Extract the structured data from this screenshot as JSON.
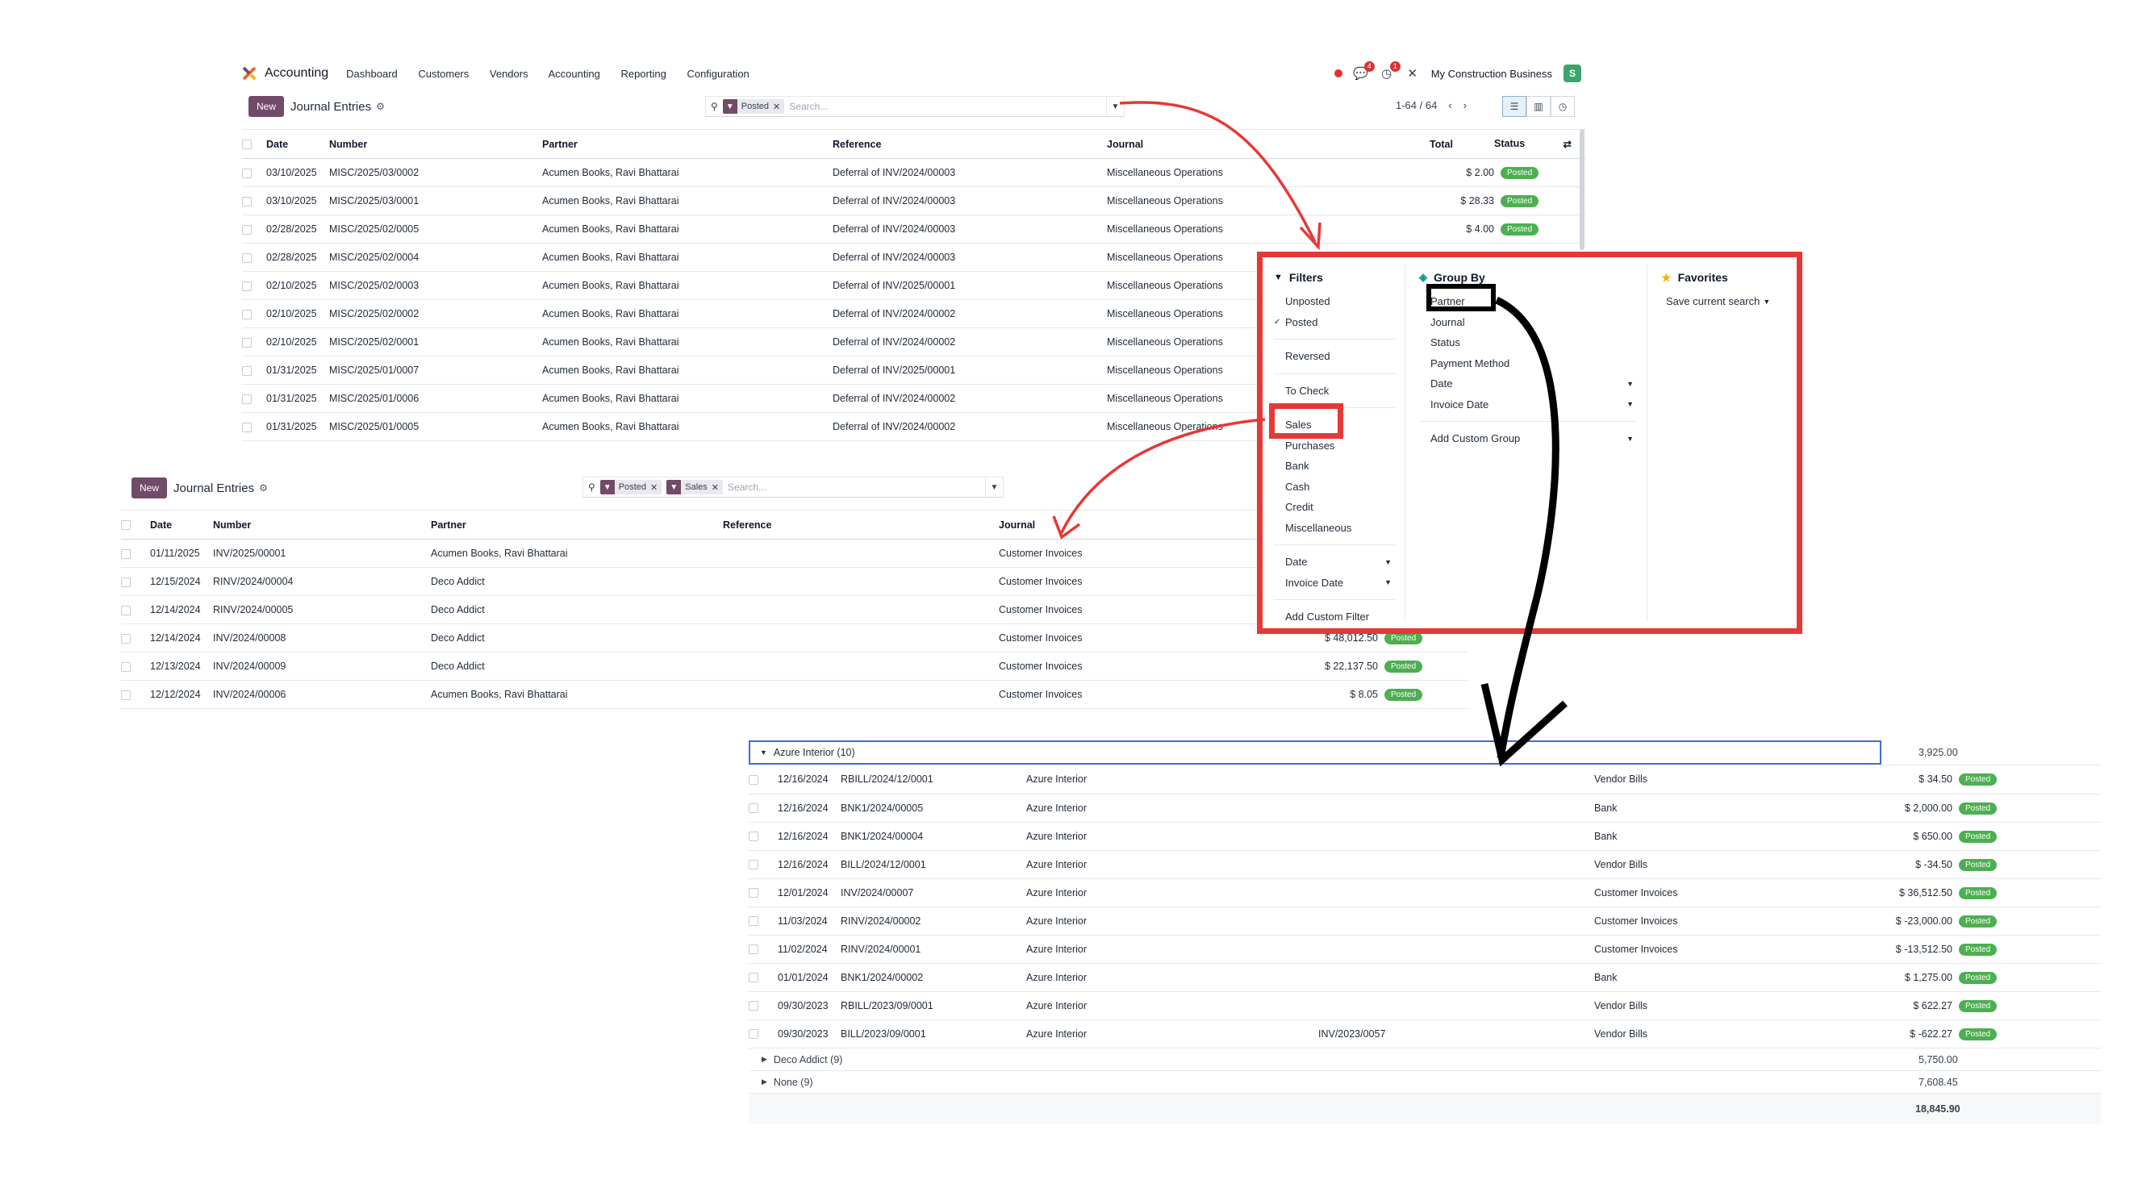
{
  "navbar": {
    "app_name": "Accounting",
    "menu": [
      "Dashboard",
      "Customers",
      "Vendors",
      "Accounting",
      "Reporting",
      "Configuration"
    ],
    "chat_badge": "4",
    "activity_badge": "1",
    "company": "My Construction Business",
    "avatar_letter": "S"
  },
  "panel1": {
    "new_label": "New",
    "title": "Journal Entries",
    "facet_posted": "Posted",
    "search_placeholder": "Search...",
    "pager": "1-64 / 64",
    "columns": [
      "Date",
      "Number",
      "Partner",
      "Reference",
      "Journal",
      "Total",
      "Status"
    ],
    "rows": [
      [
        "03/10/2025",
        "MISC/2025/03/0002",
        "Acumen Books, Ravi Bhattarai",
        "Deferral of INV/2024/00003",
        "Miscellaneous Operations",
        "$ 2.00",
        "Posted"
      ],
      [
        "03/10/2025",
        "MISC/2025/03/0001",
        "Acumen Books, Ravi Bhattarai",
        "Deferral of INV/2024/00003",
        "Miscellaneous Operations",
        "$ 28.33",
        "Posted"
      ],
      [
        "02/28/2025",
        "MISC/2025/02/0005",
        "Acumen Books, Ravi Bhattarai",
        "Deferral of INV/2024/00003",
        "Miscellaneous Operations",
        "$ 4.00",
        "Posted"
      ],
      [
        "02/28/2025",
        "MISC/2025/02/0004",
        "Acumen Books, Ravi Bhattarai",
        "Deferral of INV/2024/00003",
        "Miscellaneous Operations",
        "",
        ""
      ],
      [
        "02/10/2025",
        "MISC/2025/02/0003",
        "Acumen Books, Ravi Bhattarai",
        "Deferral of INV/2025/00001",
        "Miscellaneous Operations",
        "",
        ""
      ],
      [
        "02/10/2025",
        "MISC/2025/02/0002",
        "Acumen Books, Ravi Bhattarai",
        "Deferral of INV/2024/00002",
        "Miscellaneous Operations",
        "",
        ""
      ],
      [
        "02/10/2025",
        "MISC/2025/02/0001",
        "Acumen Books, Ravi Bhattarai",
        "Deferral of INV/2024/00002",
        "Miscellaneous Operations",
        "",
        ""
      ],
      [
        "01/31/2025",
        "MISC/2025/01/0007",
        "Acumen Books, Ravi Bhattarai",
        "Deferral of INV/2025/00001",
        "Miscellaneous Operations",
        "",
        ""
      ],
      [
        "01/31/2025",
        "MISC/2025/01/0006",
        "Acumen Books, Ravi Bhattarai",
        "Deferral of INV/2024/00002",
        "Miscellaneous Operations",
        "",
        ""
      ],
      [
        "01/31/2025",
        "MISC/2025/01/0005",
        "Acumen Books, Ravi Bhattarai",
        "Deferral of INV/2024/00002",
        "Miscellaneous Operations",
        "",
        ""
      ]
    ]
  },
  "panel2": {
    "new_label": "New",
    "title": "Journal Entries",
    "facet_posted": "Posted",
    "facet_sales": "Sales",
    "search_placeholder": "Search...",
    "columns": [
      "Date",
      "Number",
      "Partner",
      "Reference",
      "Journal"
    ],
    "rows": [
      [
        "01/11/2025",
        "INV/2025/00001",
        "Acumen Books, Ravi Bhattarai",
        "",
        "Customer Invoices",
        "",
        ""
      ],
      [
        "12/15/2024",
        "RINV/2024/00004",
        "Deco Addict",
        "",
        "Customer Invoices",
        "",
        ""
      ],
      [
        "12/14/2024",
        "RINV/2024/00005",
        "Deco Addict",
        "",
        "Customer Invoices",
        "",
        ""
      ],
      [
        "12/14/2024",
        "INV/2024/00008",
        "Deco Addict",
        "",
        "Customer Invoices",
        "$ 48,012.50",
        "Posted"
      ],
      [
        "12/13/2024",
        "INV/2024/00009",
        "Deco Addict",
        "",
        "Customer Invoices",
        "$ 22,137.50",
        "Posted"
      ],
      [
        "12/12/2024",
        "INV/2024/00006",
        "Acumen Books, Ravi Bhattarai",
        "",
        "Customer Invoices",
        "$ 8.05",
        "Posted"
      ]
    ]
  },
  "dropdown": {
    "filters_header": "Filters",
    "filters_group1": [
      "Unposted",
      "Posted"
    ],
    "filters_group2": [
      "Reversed"
    ],
    "filters_group3": [
      "To Check"
    ],
    "filters_group4": [
      "Sales",
      "Purchases",
      "Bank",
      "Cash",
      "Credit",
      "Miscellaneous"
    ],
    "filters_dates": [
      "Date",
      "Invoice Date"
    ],
    "add_custom_filter": "Add Custom Filter",
    "groupby_header": "Group By",
    "groupby_items": [
      "Partner",
      "Journal",
      "Status",
      "Payment Method"
    ],
    "groupby_dates": [
      "Date",
      "Invoice Date"
    ],
    "add_custom_group": "Add Custom Group",
    "favorites_header": "Favorites",
    "save_current_search": "Save current search"
  },
  "grouped": {
    "groups": [
      {
        "label": "Azure Interior (10)",
        "total": "3,925.00"
      },
      {
        "label": "Deco Addict (9)",
        "total": "5,750.00"
      },
      {
        "label": "None (9)",
        "total": "7,608.45"
      }
    ],
    "grand_total": "18,845.90",
    "rows": [
      [
        "12/16/2024",
        "RBILL/2024/12/0001",
        "Azure Interior",
        "",
        "Vendor Bills",
        "$ 34.50",
        "Posted"
      ],
      [
        "12/16/2024",
        "BNK1/2024/00005",
        "Azure Interior",
        "",
        "Bank",
        "$ 2,000.00",
        "Posted"
      ],
      [
        "12/16/2024",
        "BNK1/2024/00004",
        "Azure Interior",
        "",
        "Bank",
        "$ 650.00",
        "Posted"
      ],
      [
        "12/16/2024",
        "BILL/2024/12/0001",
        "Azure Interior",
        "",
        "Vendor Bills",
        "$ -34.50",
        "Posted"
      ],
      [
        "12/01/2024",
        "INV/2024/00007",
        "Azure Interior",
        "",
        "Customer Invoices",
        "$ 36,512.50",
        "Posted"
      ],
      [
        "11/03/2024",
        "RINV/2024/00002",
        "Azure Interior",
        "",
        "Customer Invoices",
        "$ -23,000.00",
        "Posted"
      ],
      [
        "11/02/2024",
        "RINV/2024/00001",
        "Azure Interior",
        "",
        "Customer Invoices",
        "$ -13,512.50",
        "Posted"
      ],
      [
        "01/01/2024",
        "BNK1/2024/00002",
        "Azure Interior",
        "",
        "Bank",
        "$ 1,275.00",
        "Posted"
      ],
      [
        "09/30/2023",
        "RBILL/2023/09/0001",
        "Azure Interior",
        "",
        "Vendor Bills",
        "$ 622.27",
        "Posted"
      ],
      [
        "09/30/2023",
        "BILL/2023/09/0001",
        "Azure Interior",
        "INV/2023/0057",
        "Vendor Bills",
        "$ -622.27",
        "Posted"
      ]
    ]
  },
  "colors": {
    "brand": "#714b67",
    "posted": "#4caf50",
    "highlight": "#e53935"
  }
}
